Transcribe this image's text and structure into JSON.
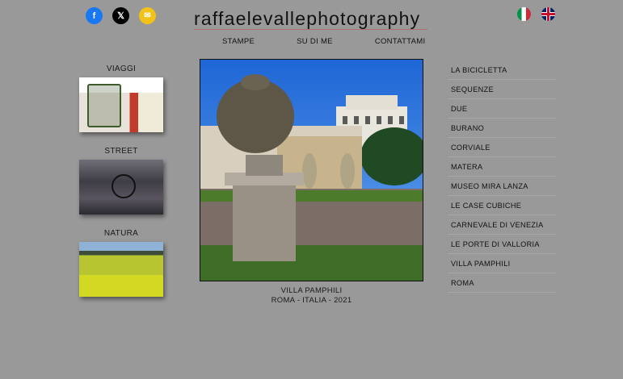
{
  "header": {
    "logo_text": "raffaelevallephotography",
    "nav": [
      "STAMPE",
      "SU DI ME",
      "CONTATTAMI"
    ]
  },
  "social": [
    "facebook-icon",
    "x-icon",
    "mail-icon"
  ],
  "languages": [
    "italian-flag",
    "english-flag"
  ],
  "categories": [
    {
      "label": "VIAGGI"
    },
    {
      "label": "STREET"
    },
    {
      "label": "NATURA"
    }
  ],
  "main_photo": {
    "caption_line1": "VILLA PAMPHILI",
    "caption_line2": "ROMA - ITALIA - 2021"
  },
  "series": [
    "LA BICICLETTA",
    "SEQUENZE",
    "DUE",
    "BURANO",
    "CORVIALE",
    "MATERA",
    "MUSEO MIRA LANZA",
    "LE CASE CUBICHE",
    "CARNEVALE DI VENEZIA",
    "LE PORTE DI VALLORIA",
    "VILLA PAMPHILI",
    "ROMA"
  ]
}
